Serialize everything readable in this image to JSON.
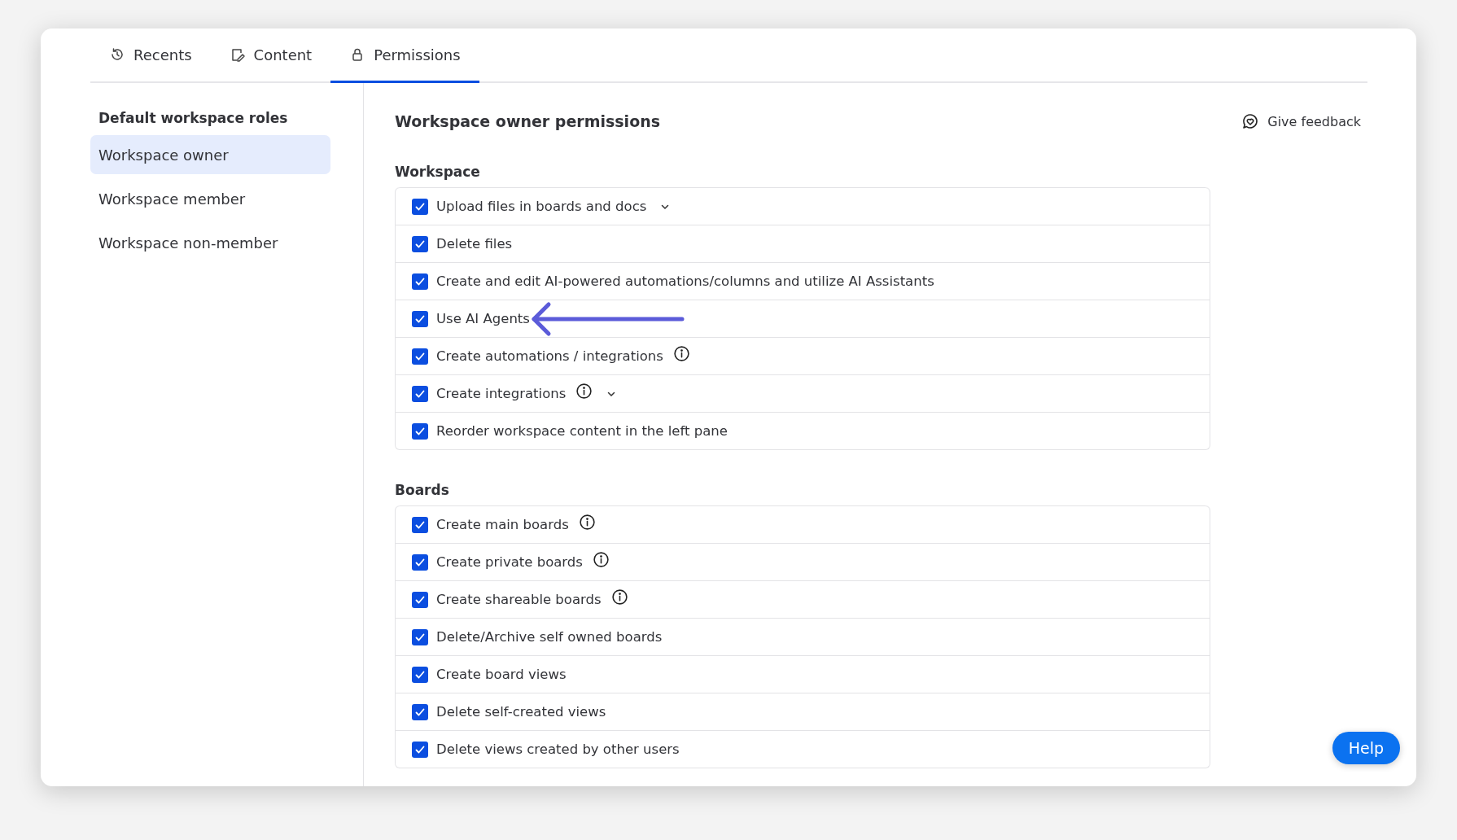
{
  "tabs": [
    {
      "label": "Recents",
      "selected": false
    },
    {
      "label": "Content",
      "selected": false
    },
    {
      "label": "Permissions",
      "selected": true
    }
  ],
  "sidebar": {
    "title": "Default workspace roles",
    "items": [
      {
        "label": "Workspace owner",
        "selected": true
      },
      {
        "label": "Workspace member",
        "selected": false
      },
      {
        "label": "Workspace non-member",
        "selected": false
      }
    ]
  },
  "main": {
    "title": "Workspace owner permissions",
    "feedback": "Give feedback",
    "sections": [
      {
        "title": "Workspace",
        "rows": [
          {
            "label": "Upload files in boards and docs",
            "checked": true,
            "info": false,
            "dropdown": true,
            "annotated": false
          },
          {
            "label": "Delete files",
            "checked": true,
            "info": false,
            "dropdown": false,
            "annotated": false
          },
          {
            "label": "Create and edit AI-powered automations/columns and utilize AI Assistants",
            "checked": true,
            "info": false,
            "dropdown": false,
            "annotated": false
          },
          {
            "label": "Use AI Agents",
            "checked": true,
            "info": false,
            "dropdown": false,
            "annotated": true
          },
          {
            "label": "Create automations / integrations",
            "checked": true,
            "info": true,
            "dropdown": false,
            "annotated": false
          },
          {
            "label": "Create integrations",
            "checked": true,
            "info": true,
            "dropdown": true,
            "annotated": false
          },
          {
            "label": "Reorder workspace content in the left pane",
            "checked": true,
            "info": false,
            "dropdown": false,
            "annotated": false
          }
        ]
      },
      {
        "title": "Boards",
        "rows": [
          {
            "label": "Create main boards",
            "checked": true,
            "info": true,
            "dropdown": false,
            "annotated": false
          },
          {
            "label": "Create private boards",
            "checked": true,
            "info": true,
            "dropdown": false,
            "annotated": false
          },
          {
            "label": "Create shareable boards",
            "checked": true,
            "info": true,
            "dropdown": false,
            "annotated": false
          },
          {
            "label": "Delete/Archive self owned boards",
            "checked": true,
            "info": false,
            "dropdown": false,
            "annotated": false
          },
          {
            "label": "Create board views",
            "checked": true,
            "info": false,
            "dropdown": false,
            "annotated": false
          },
          {
            "label": "Delete self-created views",
            "checked": true,
            "info": false,
            "dropdown": false,
            "annotated": false
          },
          {
            "label": "Delete views created by other users",
            "checked": true,
            "info": false,
            "dropdown": false,
            "annotated": false
          }
        ]
      }
    ]
  },
  "help": "Help"
}
